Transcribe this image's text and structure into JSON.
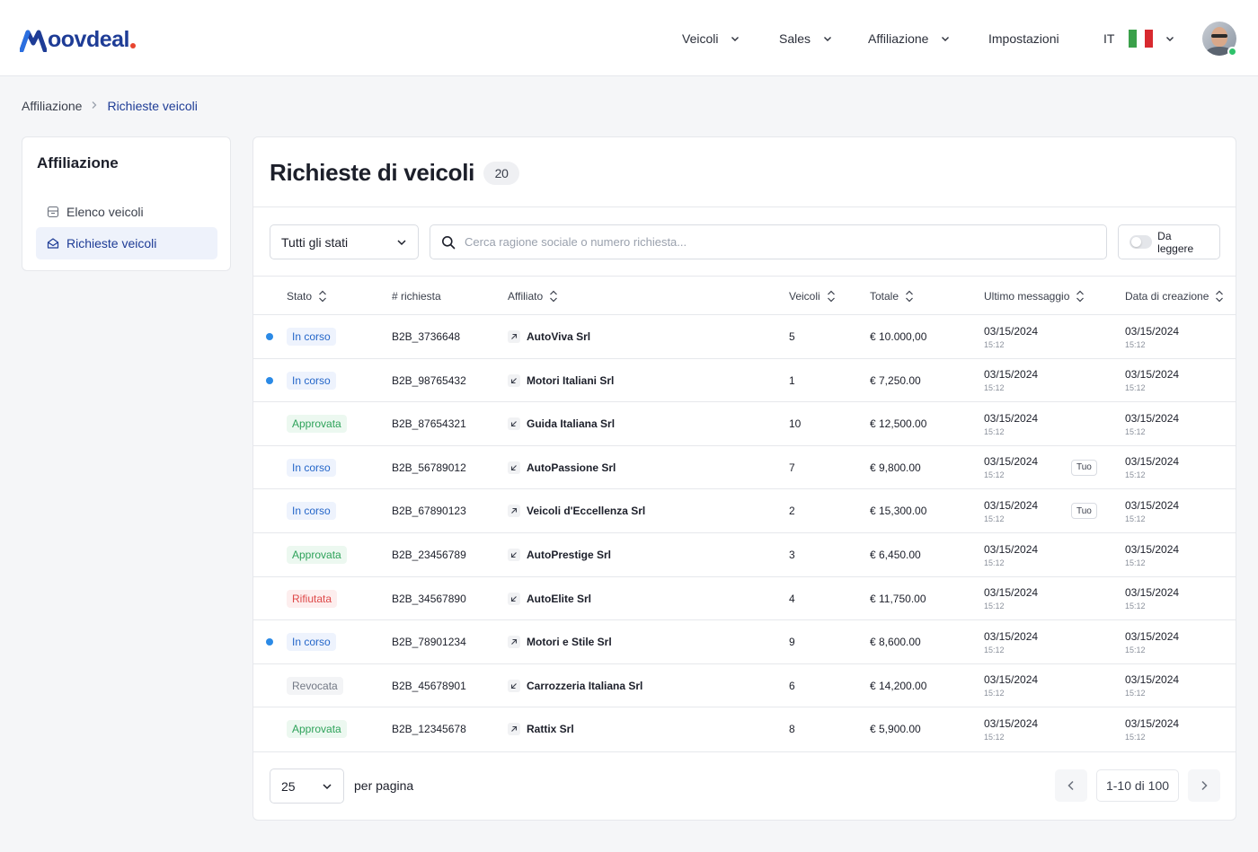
{
  "brand": {
    "logo_text": "oovdeal",
    "colors": {
      "primary": "#1e3c96",
      "accent": "#e8452f"
    }
  },
  "nav": {
    "items": [
      {
        "label": "Veicoli",
        "dropdown": true
      },
      {
        "label": "Sales",
        "dropdown": true
      },
      {
        "label": "Affiliazione",
        "dropdown": true
      },
      {
        "label": "Impostazioni",
        "dropdown": false
      }
    ],
    "language": "IT",
    "user_online": true
  },
  "breadcrumb": {
    "parent": "Affiliazione",
    "current": "Richieste veicoli"
  },
  "sidebar": {
    "title": "Affiliazione",
    "items": [
      {
        "label": "Elenco veicoli",
        "icon": "archive-icon",
        "active": false
      },
      {
        "label": "Richieste veicoli",
        "icon": "mail-open-icon",
        "active": true
      }
    ]
  },
  "main": {
    "title": "Richieste di veicoli",
    "count": "20",
    "filters": {
      "status_select": "Tutti gli stati",
      "search_placeholder": "Cerca ragione sociale o numero richiesta...",
      "unread_toggle_label": "Da leggere"
    },
    "columns": {
      "stato": "Stato",
      "richiesta": "# richiesta",
      "affiliato": "Affiliato",
      "veicoli": "Veicoli",
      "totale": "Totale",
      "ultimo_messaggio": "Ultimo messaggio",
      "data_creazione": "Data di creazione"
    },
    "rows": [
      {
        "unread": true,
        "status": "In corso",
        "status_type": "in-corso",
        "id": "B2B_3736648",
        "direction": "out",
        "affiliate": "AutoViva Srl",
        "vehicles": "5",
        "total": "€ 10.000,00",
        "last_date": "03/15/2024",
        "last_time": "15:12",
        "tuo": "",
        "created_date": "03/15/2024",
        "created_time": "15:12"
      },
      {
        "unread": true,
        "status": "In corso",
        "status_type": "in-corso",
        "id": "B2B_98765432",
        "direction": "in",
        "affiliate": "Motori Italiani Srl",
        "vehicles": "1",
        "total": "€ 7,250.00",
        "last_date": "03/15/2024",
        "last_time": "15:12",
        "tuo": "",
        "created_date": "03/15/2024",
        "created_time": "15:12"
      },
      {
        "unread": false,
        "status": "Approvata",
        "status_type": "approvata",
        "id": "B2B_87654321",
        "direction": "in",
        "affiliate": "Guida Italiana Srl",
        "vehicles": "10",
        "total": "€ 12,500.00",
        "last_date": "03/15/2024",
        "last_time": "15:12",
        "tuo": "",
        "created_date": "03/15/2024",
        "created_time": "15:12"
      },
      {
        "unread": false,
        "status": "In corso",
        "status_type": "in-corso",
        "id": "B2B_56789012",
        "direction": "in",
        "affiliate": "AutoPassione Srl",
        "vehicles": "7",
        "total": "€ 9,800.00",
        "last_date": "03/15/2024",
        "last_time": "15:12",
        "tuo": "Tuo",
        "created_date": "03/15/2024",
        "created_time": "15:12"
      },
      {
        "unread": false,
        "status": "In corso",
        "status_type": "in-corso",
        "id": "B2B_67890123",
        "direction": "out",
        "affiliate": "Veicoli d'Eccellenza Srl",
        "vehicles": "2",
        "total": "€ 15,300.00",
        "last_date": "03/15/2024",
        "last_time": "15:12",
        "tuo": "Tuo",
        "created_date": "03/15/2024",
        "created_time": "15:12"
      },
      {
        "unread": false,
        "status": "Approvata",
        "status_type": "approvata",
        "id": "B2B_23456789",
        "direction": "in",
        "affiliate": "AutoPrestige Srl",
        "vehicles": "3",
        "total": "€ 6,450.00",
        "last_date": "03/15/2024",
        "last_time": "15:12",
        "tuo": "",
        "created_date": "03/15/2024",
        "created_time": "15:12"
      },
      {
        "unread": false,
        "status": "Rifiutata",
        "status_type": "rifiutata",
        "id": "B2B_34567890",
        "direction": "in",
        "affiliate": "AutoElite Srl",
        "vehicles": "4",
        "total": "€ 11,750.00",
        "last_date": "03/15/2024",
        "last_time": "15:12",
        "tuo": "",
        "created_date": "03/15/2024",
        "created_time": "15:12"
      },
      {
        "unread": true,
        "status": "In corso",
        "status_type": "in-corso",
        "id": "B2B_78901234",
        "direction": "out",
        "affiliate": "Motori e Stile Srl",
        "vehicles": "9",
        "total": "€ 8,600.00",
        "last_date": "03/15/2024",
        "last_time": "15:12",
        "tuo": "",
        "created_date": "03/15/2024",
        "created_time": "15:12"
      },
      {
        "unread": false,
        "status": "Revocata",
        "status_type": "revocata",
        "id": "B2B_45678901",
        "direction": "in",
        "affiliate": "Carrozzeria Italiana Srl",
        "vehicles": "6",
        "total": "€ 14,200.00",
        "last_date": "03/15/2024",
        "last_time": "15:12",
        "tuo": "",
        "created_date": "03/15/2024",
        "created_time": "15:12"
      },
      {
        "unread": false,
        "status": "Approvata",
        "status_type": "approvata",
        "id": "B2B_12345678",
        "direction": "out",
        "affiliate": "Rattix Srl",
        "vehicles": "8",
        "total": "€ 5,900.00",
        "last_date": "03/15/2024",
        "last_time": "15:12",
        "tuo": "",
        "created_date": "03/15/2024",
        "created_time": "15:12"
      }
    ],
    "pagination": {
      "per_page": "25",
      "per_page_label": "per pagina",
      "range": "1-10 di 100"
    }
  }
}
